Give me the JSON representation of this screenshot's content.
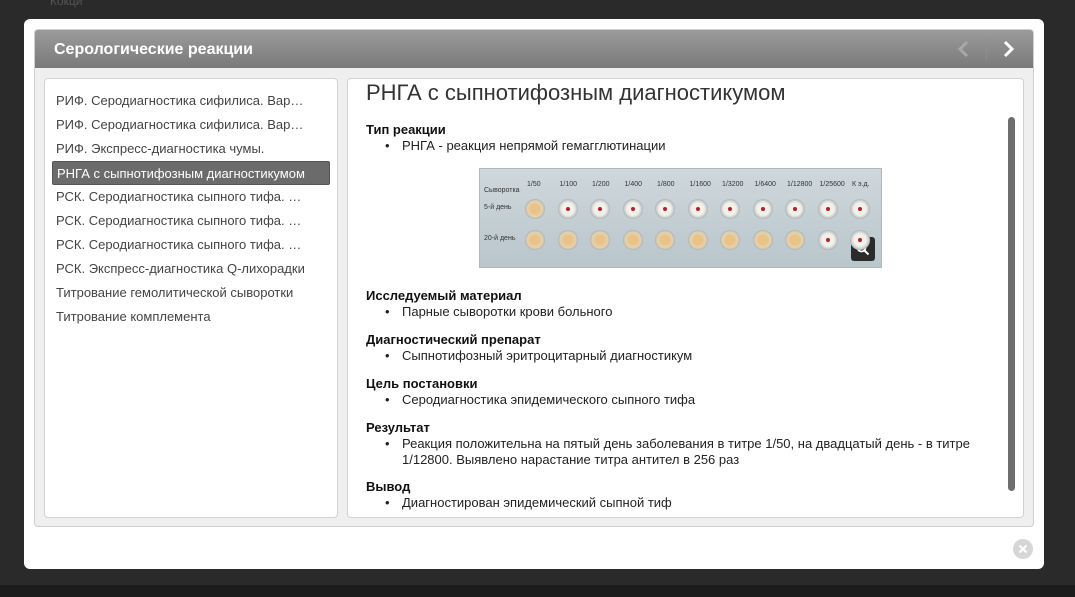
{
  "background_peek": "Кокци",
  "modal": {
    "title": "Серологические реакции"
  },
  "sidebar": {
    "items": [
      {
        "label": "РИФ. Серодиагностика сифилиса. Вар…",
        "active": false
      },
      {
        "label": "РИФ. Серодиагностика сифилиса. Вар…",
        "active": false
      },
      {
        "label": "РИФ. Экспресс-диагностика чумы.",
        "active": false
      },
      {
        "label": "РНГА с сыпнотифозным диагностикумом",
        "active": true
      },
      {
        "label": "РСК. Серодиагностика сыпного тифа. …",
        "active": false
      },
      {
        "label": "РСК. Серодиагностика сыпного тифа. …",
        "active": false
      },
      {
        "label": "РСК. Серодиагностика сыпного тифа. …",
        "active": false
      },
      {
        "label": "РСК. Экспресс-диагностика Q-лихорадки",
        "active": false
      },
      {
        "label": "Титрование гемолитической сыворотки",
        "active": false
      },
      {
        "label": "Титрование комплемента",
        "active": false
      }
    ]
  },
  "content": {
    "title": "РНГА с сыпнотифозным диагностикумом",
    "sections": [
      {
        "heading": "Тип реакции",
        "items": [
          "РНГА - реакция непрямой гемагглютинации"
        ]
      },
      {
        "heading": "Исследуемый материал",
        "items": [
          "Парные сыворотки крови больного"
        ]
      },
      {
        "heading": "Диагностический препарат",
        "items": [
          "Сыпнотифозный эритроцитарный диагностикум"
        ]
      },
      {
        "heading": "Цель постановки",
        "items": [
          "Серодиагностика эпидемического сыпного тифа"
        ]
      },
      {
        "heading": "Результат",
        "items": [
          "Реакция положительна на пятый день заболевания в титре 1/50, на двадцатый день - в титре 1/12800. Выявлено нарастание титра антител в 256 раз"
        ]
      },
      {
        "heading": "Вывод",
        "items": [
          "Диагностирован эпидемический сыпной тиф"
        ]
      }
    ],
    "plate": {
      "row_header": "Сыворотка",
      "dilutions": [
        "1/50",
        "1/100",
        "1/200",
        "1/400",
        "1/800",
        "1/1600",
        "1/3200",
        "1/6400",
        "1/12800",
        "1/25600",
        "К э.д."
      ],
      "rows": [
        "5-й день",
        "20-й день"
      ]
    }
  },
  "icons": {
    "prev": "chevron-left-icon",
    "next": "chevron-right-icon",
    "zoom": "magnifier-icon",
    "close": "close-icon"
  },
  "colors": {
    "titlebar": "#8a8a8a",
    "active_item": "#6b6b6b"
  }
}
